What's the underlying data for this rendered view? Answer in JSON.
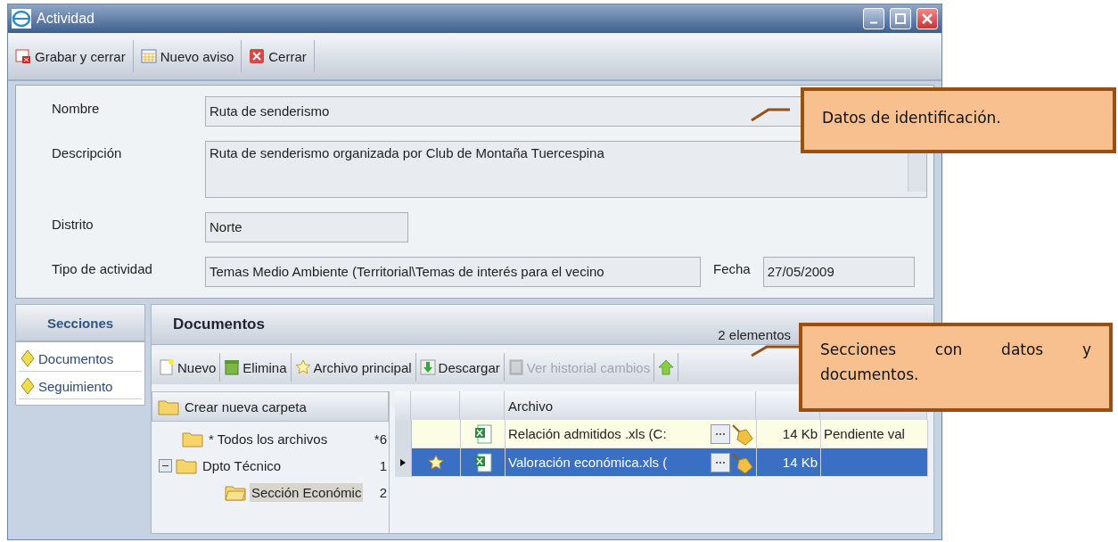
{
  "window": {
    "title": "Actividad"
  },
  "toolbar": [
    {
      "label": "Grabar y cerrar",
      "kind": "save"
    },
    {
      "label": "Nuevo aviso",
      "kind": "calendar"
    },
    {
      "label": "Cerrar",
      "kind": "close"
    }
  ],
  "form": {
    "nombre": {
      "label": "Nombre",
      "value": "Ruta de senderismo"
    },
    "descripcion": {
      "label": "Descripción",
      "value": "Ruta de senderismo organizada por Club de Montaña Tuercespina"
    },
    "distrito": {
      "label": "Distrito",
      "value": "Norte"
    },
    "tipo": {
      "label": "Tipo de actividad",
      "value": "Temas Medio Ambiente (Territorial\\Temas de interés para el  vecino"
    },
    "fecha": {
      "label": "Fecha",
      "value": "27/05/2009"
    }
  },
  "sections": {
    "title": "Secciones",
    "items": [
      {
        "label": "Documentos"
      },
      {
        "label": "Seguimiento"
      }
    ]
  },
  "documents": {
    "title": "Documentos",
    "count": "2 elementos",
    "toolbar": [
      {
        "label": "Nuevo",
        "kind": "new",
        "disabled": false
      },
      {
        "label": "Elimina",
        "kind": "delete",
        "disabled": false
      },
      {
        "label": "Archivo principal",
        "kind": "star",
        "disabled": false
      },
      {
        "label": "Descargar",
        "kind": "download",
        "disabled": false
      },
      {
        "label": "Ver historial  cambios",
        "kind": "history",
        "disabled": true
      },
      {
        "kind": "upload",
        "disabled": false
      }
    ],
    "tree": {
      "create_label": "Crear nueva carpeta",
      "nodes": [
        {
          "label": "* Todos los archivos",
          "count": "*6",
          "selected": false
        },
        {
          "label": "Dpto  Técnico",
          "count": "1",
          "selected": false,
          "expanded": true,
          "children": [
            {
              "label": "Sección Económic",
              "count": "2",
              "selected": true
            }
          ]
        }
      ]
    },
    "grid": {
      "columns": [
        {
          "kind": "rowhead"
        },
        {
          "kind": "star"
        },
        {
          "kind": "icon"
        },
        {
          "kind": "name",
          "label": "Archivo"
        },
        {
          "kind": "size"
        },
        {
          "kind": "comment"
        }
      ],
      "rows": [
        {
          "file": "Relación admitidos .xls (C:",
          "size": "14 Kb",
          "comment": "Pendiente val",
          "starred": false,
          "selected": false
        },
        {
          "file": "Valoración económica.xls (",
          "size": "14 Kb",
          "starred": true,
          "selected": true
        }
      ]
    }
  },
  "callouts": [
    {
      "text": "Datos de identificación."
    },
    {
      "text": "Secciones con datos y documentos."
    }
  ]
}
